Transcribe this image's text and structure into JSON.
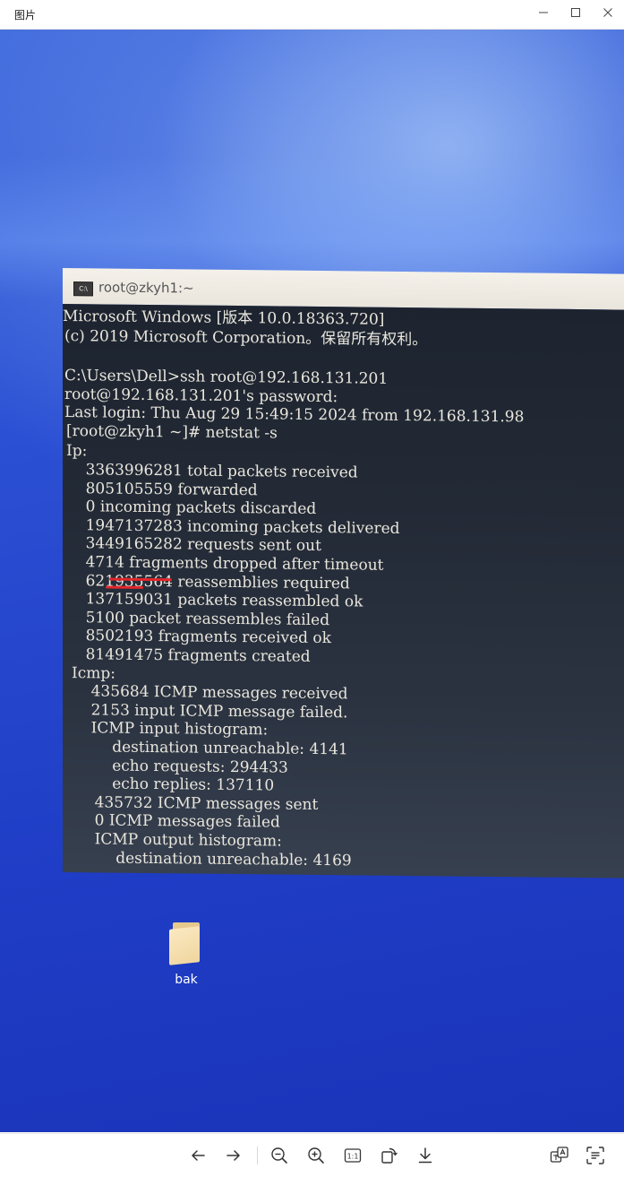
{
  "window": {
    "title": "图片",
    "controls": [
      "minimize-icon",
      "maximize-icon",
      "close-icon"
    ]
  },
  "terminal": {
    "title": "root@zkyh1:~",
    "icon_text": "C:\\",
    "lines": [
      "Microsoft Windows [版本 10.0.18363.720]",
      "(c) 2019 Microsoft Corporation。保留所有权利。",
      "",
      "C:\\Users\\Dell>ssh root@192.168.131.201",
      "root@192.168.131.201's password:",
      "Last login: Thu Aug 29 15:49:15 2024 from 192.168.131.98",
      "[root@zkyh1 ~]# netstat -s",
      "Ip:",
      "    3363996281 total packets received",
      "    805105559 forwarded",
      "    0 incoming packets discarded",
      "    1947137283 incoming packets delivered",
      "    3449165282 requests sent out",
      "    4714 fragments dropped after timeout",
      "    621935564 reassemblies required",
      "    137159031 packets reassembled ok",
      "    5100 packet reassembles failed",
      "    8502193 fragments received ok",
      "    81491475 fragments created",
      "Icmp:",
      "    435684 ICMP messages received",
      "    2153 input ICMP message failed.",
      "    ICMP input histogram:",
      "        destination unreachable: 4141",
      "        echo requests: 294433",
      "        echo replies: 137110",
      "    435732 ICMP messages sent",
      "    0 ICMP messages failed",
      "    ICMP output histogram:",
      "        destination unreachable: 4169"
    ]
  },
  "desktop": {
    "folder_label": "bak"
  },
  "toolbar": {
    "buttons": [
      "previous-icon",
      "next-icon",
      "zoom-out-icon",
      "zoom-in-icon",
      "actual-size-icon",
      "rotate-icon",
      "download-icon",
      "translate-icon",
      "text-extract-icon"
    ],
    "actual_size_label": "1:1"
  },
  "colors": {
    "terminal_text": "#e9e6dc",
    "highlight_mark": "#e2262a",
    "desktop_blue": "#2b4fd3"
  }
}
